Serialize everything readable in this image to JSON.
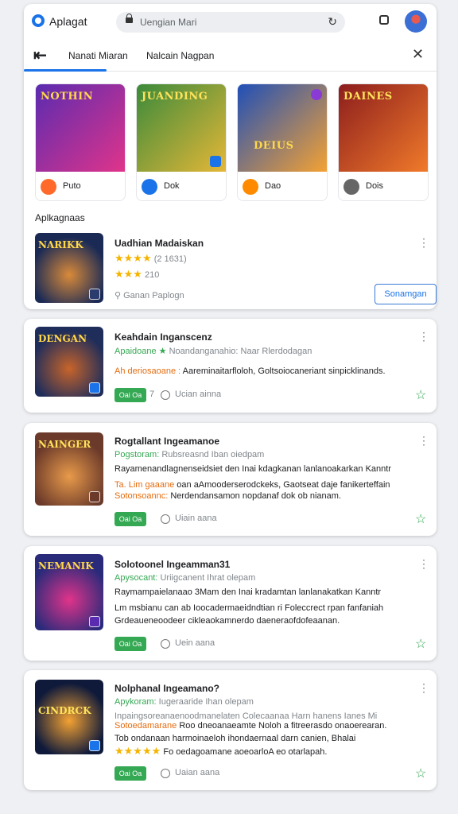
{
  "header": {
    "app_title": "Aplagat",
    "search_text": "Uengian Mari"
  },
  "nav": {
    "tab1": "Nanati Miaran",
    "tab2": "Nalcain  Nagpan"
  },
  "featured_games": [
    {
      "art_text": "NOTHIN",
      "label": "Puto",
      "colors": [
        "#5a2bb0",
        "#e0348a"
      ],
      "icon_color": "#ff6a2b"
    },
    {
      "art_text": "JUANDING",
      "label": "Dok",
      "colors": [
        "#3b8a3a",
        "#e5b738"
      ],
      "icon_color": "#1a73e8"
    },
    {
      "art_text": "DEIUS",
      "label": "Dao",
      "colors": [
        "#1f4fb8",
        "#f4a233"
      ],
      "icon_color": "#ff8a00"
    },
    {
      "art_text": "DAINES",
      "label": "Dois",
      "colors": [
        "#8c1d1d",
        "#f07a2a"
      ],
      "icon_color": "#666666"
    }
  ],
  "section_title": "Aplkagnaas",
  "top_app": {
    "thumb_text": "NARIKK",
    "title": "Uadhian Madaiskan",
    "rating_stars": "★★★★",
    "rating_text": "(2 1631)",
    "stars2": "★★★",
    "stars2_text": "210",
    "meta": "Ganan Paplogn",
    "button": "Sonamgan"
  },
  "apps": [
    {
      "thumb_text": "DENGAN",
      "title": "Keahdain Inganscenz",
      "line1_green": "Apaidoane ★",
      "line1_rest": "Noandanganahio: Naar Rlerdodagan",
      "line2_orange": "Ah deriosaoane :",
      "line2_rest": "Aareminaitarfloloh, Goltsoiocaneriant sinpicklinands.",
      "line3_orange": "",
      "line3_rest": "",
      "pill": "Oai Oa",
      "extra": "7",
      "meta": "Ucian ainna"
    },
    {
      "thumb_text": "NAINGER",
      "title": "Rogtallant Ingeamanoe",
      "line1_green": "Pogstoram:",
      "line1_rest": "Rubsreasnd Iban oiedpam",
      "line2_orange": "",
      "line2_rest": "Rayamenandlagnenseidsiet den Inai kdagkanan lanlanoakarkan Kanntr",
      "line3_orange": "Ta. Lim gaaane",
      "line3_rest": "oan aAmooderserodckeks, Gaotseat daje fanikerteffain",
      "line4_orange": "Sotonsoannc:",
      "line4_rest": "Nerdendansamon nopdanaf dok ob nianam.",
      "pill": "Oai Oa",
      "meta": "Uiain aana"
    },
    {
      "thumb_text": "NEMANIK",
      "title": "Solotoonel Ingeamman31",
      "line1_green": "Apysocant:",
      "line1_rest": "Uriigcanent Ihrat olepam",
      "line2_orange": "",
      "line2_rest": "Raymampaielanaao 3Mam den Inai kradamtan lanlanakatkan Kanntr",
      "line3_orange": "",
      "line3_rest": "Lm msbianu can ab Ioocadermaeidndtian ri Foleccrect rpan fanfaniah",
      "line4_orange": "",
      "line4_rest": "Grdeaueneoodeer cikleaokamnerdo daeneraofdofeaanan.",
      "pill": "Oai Oa",
      "meta": "Uein aana"
    },
    {
      "thumb_text": "CINDRCK",
      "title": "Nolphanal Ingeamano?",
      "line1_green": "Apykoram:",
      "line1_rest": "Iugeraaride Ihan olepam",
      "line2_orange": "",
      "line2_rest": "Inpaingsoreanaenoodmanelaten Colecaanaa Harn hanens Ianes Mi",
      "line3_orange": "Sotoedamarane",
      "line3_rest": "Roo dneoanaeamte Noloh a fitreerasdo onaoerearan.",
      "line4_orange": "",
      "line4_rest": "Tob ondanaan harmoinaeloh ihondaernaal darn canien, Bhalai",
      "stars": "★★★★★",
      "line5_rest": "Fo oedagoamane aoeoarloA eo otarlapah.",
      "pill": "Oai Oa",
      "meta": "Uaian aana"
    }
  ]
}
